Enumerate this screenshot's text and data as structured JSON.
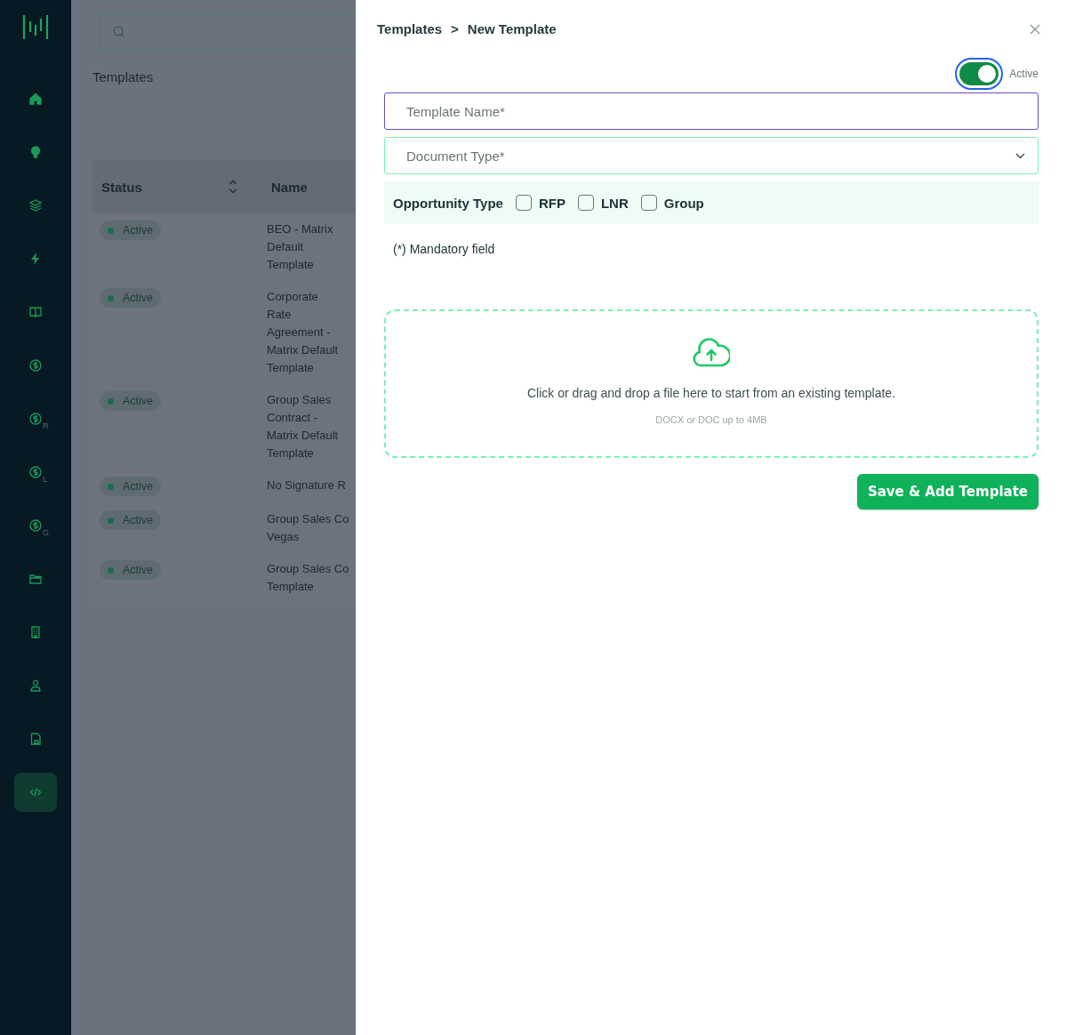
{
  "sidebar": {
    "items": [
      {
        "selected": false
      },
      {
        "selected": false
      },
      {
        "selected": false
      },
      {
        "selected": false
      },
      {
        "selected": false
      },
      {
        "selected": false
      },
      {
        "sub": "R",
        "selected": false
      },
      {
        "sub": "L",
        "selected": false
      },
      {
        "sub": "G",
        "selected": false
      },
      {
        "selected": false
      },
      {
        "selected": false
      },
      {
        "selected": false
      },
      {
        "selected": false
      },
      {
        "selected": true
      }
    ]
  },
  "page": {
    "heading": "Templates",
    "table": {
      "columns": [
        "Status",
        "Name"
      ],
      "rows": [
        {
          "status": "Active",
          "name": "BEO - Matrix\nDefault\nTemplate"
        },
        {
          "status": "Active",
          "name": "Corporate\nRate\nAgreement -\nMatrix Default\nTemplate"
        },
        {
          "status": "Active",
          "name": "Group Sales\nContract -\nMatrix Default\nTemplate"
        },
        {
          "status": "Active",
          "name": "No Signature R"
        },
        {
          "status": "Active",
          "name": "Group Sales Co\nVegas"
        },
        {
          "status": "Active",
          "name": "Group Sales Co\nTemplate"
        }
      ]
    }
  },
  "drawer": {
    "breadcrumb": [
      "Templates",
      "New Template"
    ],
    "separator": ">",
    "active_toggle": {
      "label": "Active",
      "on": true
    },
    "template_name": {
      "placeholder": "Template Name*"
    },
    "document_type": {
      "placeholder": "Document Type*"
    },
    "opportunity_type": {
      "label": "Opportunity Type",
      "options": [
        {
          "label": "RFP",
          "checked": false
        },
        {
          "label": "LNR",
          "checked": false
        },
        {
          "label": "Group",
          "checked": false
        }
      ]
    },
    "note": "(*) Mandatory field",
    "dropzone": {
      "text": "Click or drag and drop a file here to start from an existing template.",
      "hint": "DOCX or DOC up to 4MB"
    },
    "save_button": "Save & Add Template"
  }
}
